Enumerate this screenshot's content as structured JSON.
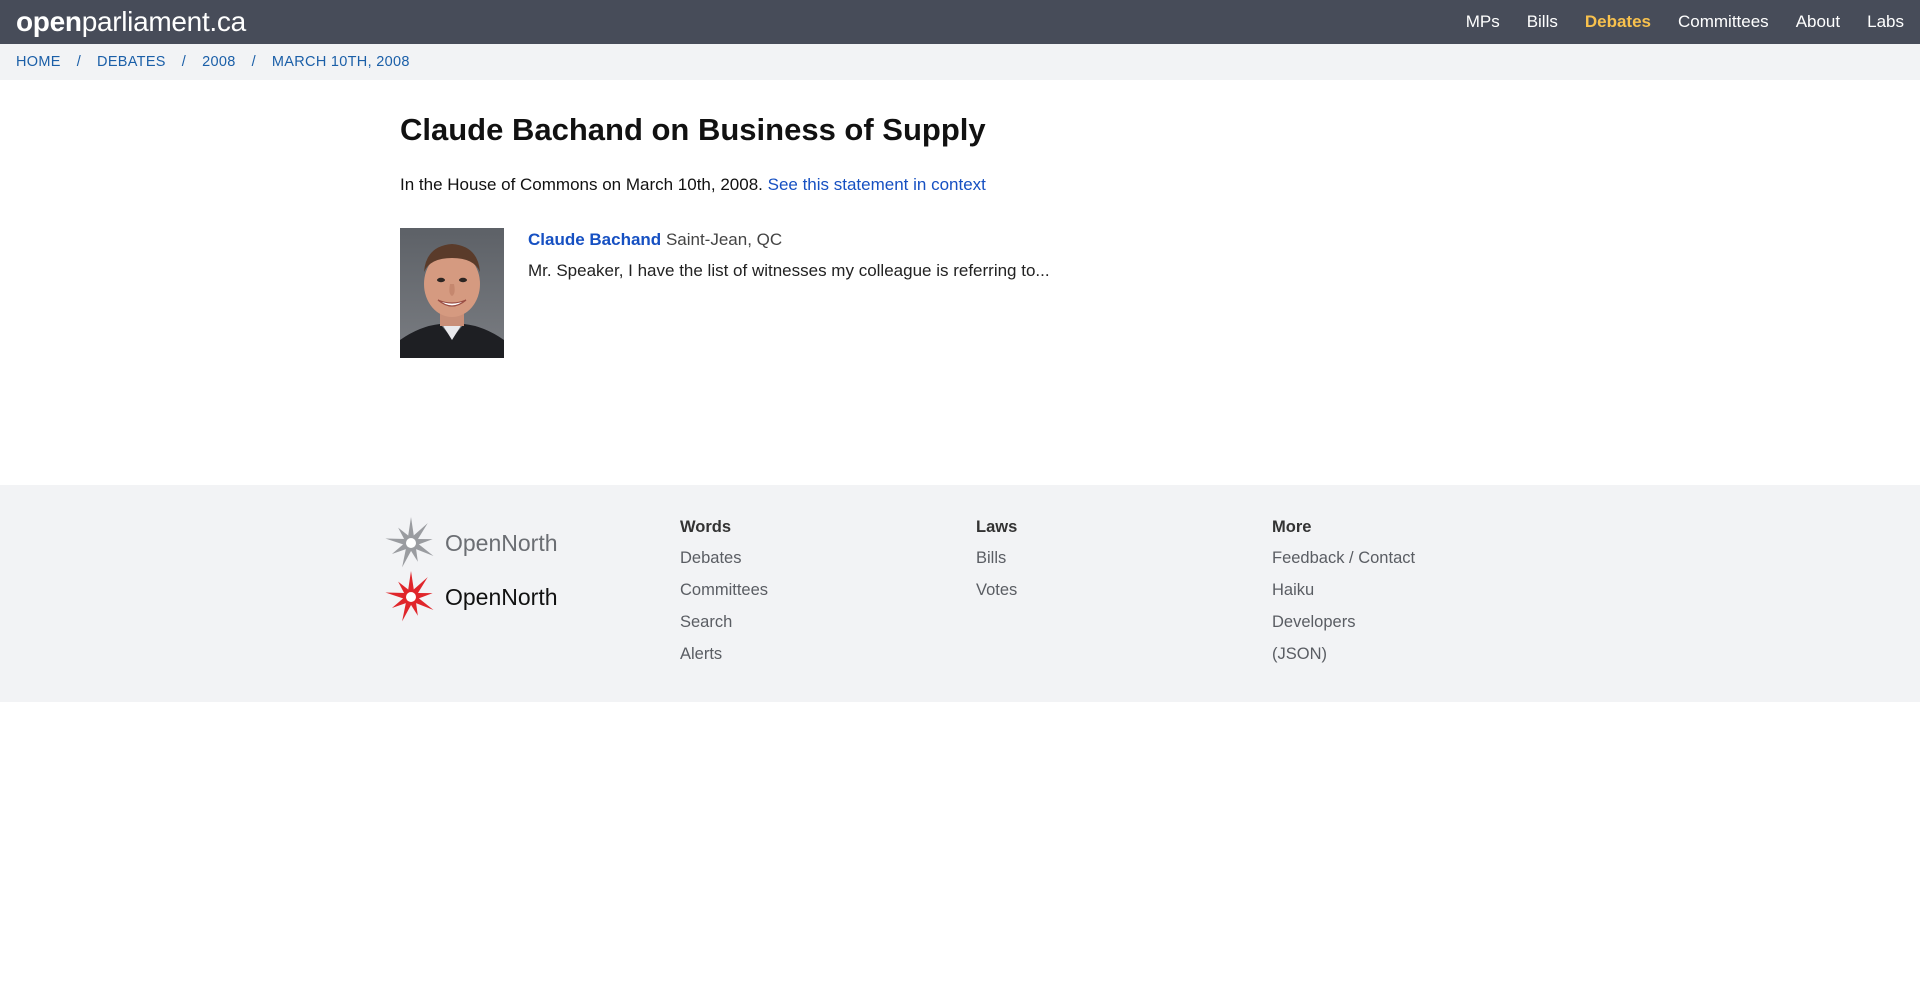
{
  "header": {
    "logo_bold": "open",
    "logo_light": "parliament.ca",
    "nav": [
      {
        "label": "MPs"
      },
      {
        "label": "Bills"
      },
      {
        "label": "Debates"
      },
      {
        "label": "Committees"
      },
      {
        "label": "About"
      },
      {
        "label": "Labs"
      }
    ],
    "active_color": "#f8c14d"
  },
  "breadcrumb": [
    "HOME",
    "DEBATES",
    "2008",
    "MARCH 10TH, 2008"
  ],
  "main": {
    "title": "Claude Bachand on Business of Supply",
    "context_text": "In the House of Commons on March 10th, 2008.",
    "context_link": "See this statement in context",
    "speaker_name": "Claude Bachand",
    "speaker_riding": "Saint-Jean, QC",
    "statement": "Mr. Speaker, I have the list of witnesses my colleague is referring to..."
  },
  "footer": {
    "brand": [
      "OpenNorth",
      "OpenNorth"
    ],
    "columns": [
      {
        "heading": "Words",
        "links": [
          "Debates",
          "Committees",
          "Search",
          "Alerts"
        ]
      },
      {
        "heading": "Laws",
        "links": [
          "Bills",
          "Votes"
        ]
      },
      {
        "heading": "More",
        "links": [
          "Feedback / Contact",
          "Haiku",
          "Developers",
          "(JSON)"
        ]
      }
    ]
  }
}
